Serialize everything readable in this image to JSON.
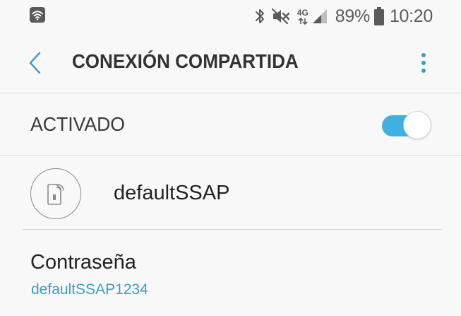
{
  "status_bar": {
    "icons_left": [
      "wifi-hotspot-icon"
    ],
    "icons_right": [
      "bluetooth-icon",
      "mute-icon",
      "4g-signal-icon"
    ],
    "network_type": "4G",
    "battery_percent": "89%",
    "clock": "10:20"
  },
  "app_bar": {
    "title": "CONEXIÓN COMPARTIDA",
    "back_icon": "chevron-left-icon",
    "more_icon": "more-vertical-icon"
  },
  "hotspot_switch": {
    "label": "ACTIVADO",
    "state": "on"
  },
  "network": {
    "icon": "mobile-hotspot-icon",
    "name": "defaultSSAP"
  },
  "password": {
    "label": "Contraseña",
    "value": "defaultSSAP1234"
  },
  "colors": {
    "accent": "#3fb1e0",
    "link": "#3a9ccc",
    "background": "#f8f8f8",
    "text_primary": "#222222",
    "icon_gray": "#5a5a5a"
  }
}
